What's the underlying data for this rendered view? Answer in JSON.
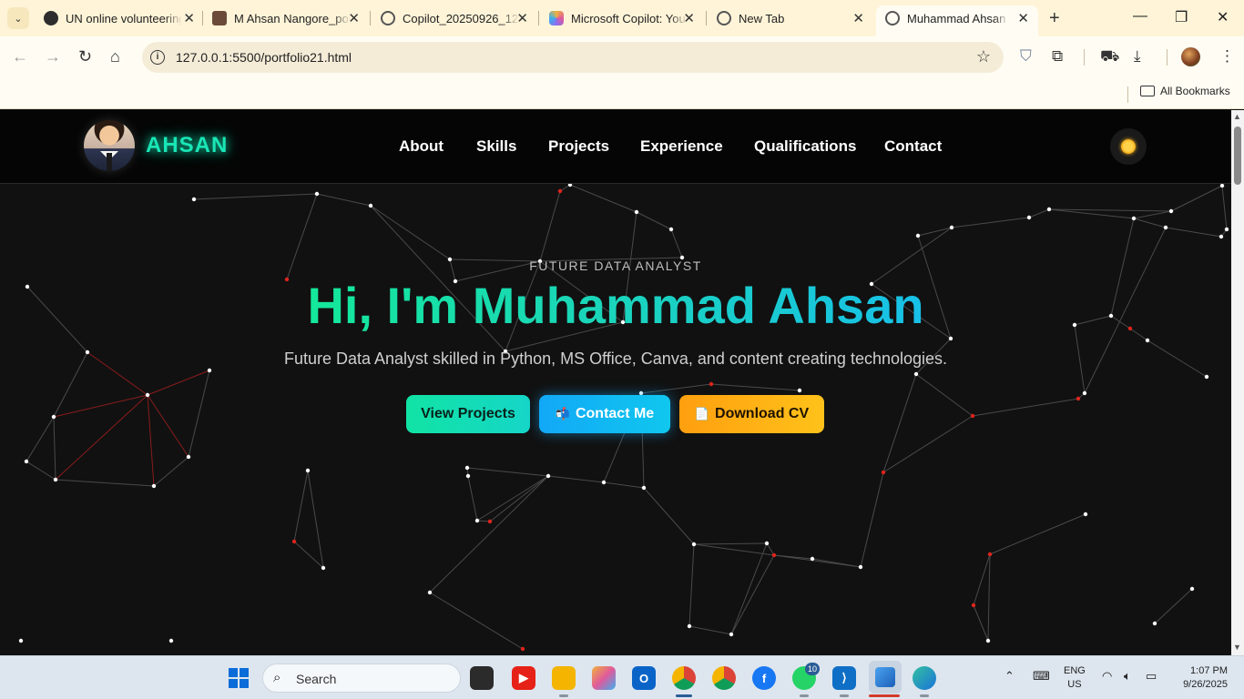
{
  "browser": {
    "tabs": [
      {
        "label": "UN online volunteering",
        "icon": "openai-icon",
        "icon_color": "#2d2d2d"
      },
      {
        "label": "M Ahsan Nangore_portfolio",
        "icon": "profile-photo-icon",
        "icon_color": "#6b4a3a"
      },
      {
        "label": "Copilot_20250926_12",
        "icon": "globe-icon",
        "icon_color": "#555555"
      },
      {
        "label": "Microsoft Copilot: Your AI companion",
        "icon": "copilot-icon",
        "icon_color": "#8a6df0"
      },
      {
        "label": "New Tab",
        "icon": "chrome-icon",
        "icon_color": "#555555"
      },
      {
        "label": "Muhammad Ahsan — Portfolio",
        "icon": "globe-icon",
        "icon_color": "#555555",
        "active": true
      }
    ],
    "close_glyph": "✕",
    "new_tab_glyph": "+",
    "url": "127.0.0.1:5500/portfolio21.html",
    "bookmarks_label": "All Bookmarks"
  },
  "nav": {
    "brand": "AHSAN",
    "links": [
      "About",
      "Skills",
      "Projects",
      "Experience",
      "Qualifications",
      "Contact"
    ]
  },
  "hero": {
    "kicker": "FUTURE DATA ANALYST",
    "title": "Hi, I'm Muhammad Ahsan",
    "subtitle": "Future Data Analyst skilled in Python, MS Office, Canva, and content creating technologies.",
    "buttons": {
      "projects": "View Projects",
      "contact": "Contact Me",
      "contact_icon": "📬",
      "cv": "Download CV",
      "cv_icon": "📄"
    }
  },
  "colors": {
    "accent_green": "#19e6b6",
    "accent_blue": "#12a8f7",
    "accent_orange": "#ff9f0f",
    "background": "#111111"
  },
  "taskbar": {
    "search_placeholder": "Search",
    "whatsapp_badge": "10",
    "lang_line1": "ENG",
    "lang_line2": "US",
    "time": "1:07 PM",
    "date": "9/26/2025"
  }
}
